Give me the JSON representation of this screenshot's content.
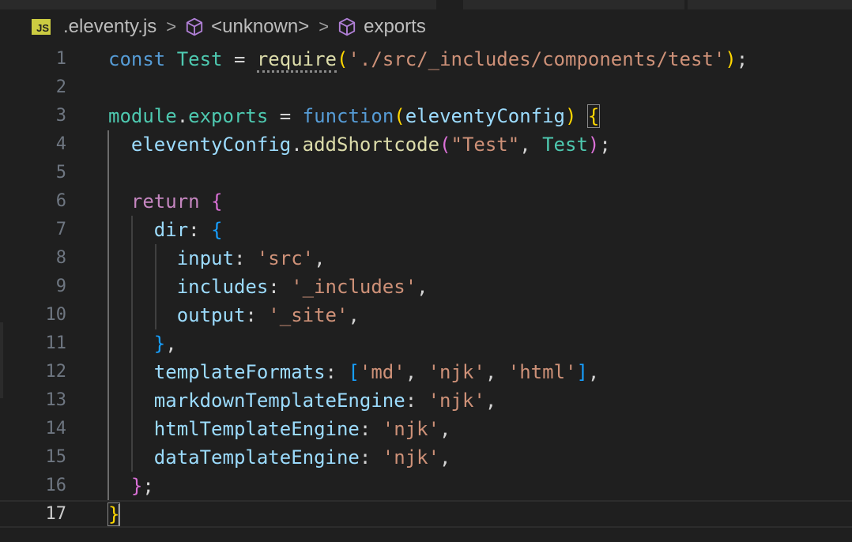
{
  "breadcrumb": {
    "file_icon_label": "JS",
    "file": ".eleventy.js",
    "item2": "<unknown>",
    "item3": "exports",
    "separator": ">"
  },
  "lines": [
    {
      "n": "1"
    },
    {
      "n": "2"
    },
    {
      "n": "3"
    },
    {
      "n": "4"
    },
    {
      "n": "5"
    },
    {
      "n": "6"
    },
    {
      "n": "7"
    },
    {
      "n": "8"
    },
    {
      "n": "9"
    },
    {
      "n": "10"
    },
    {
      "n": "11"
    },
    {
      "n": "12"
    },
    {
      "n": "13"
    },
    {
      "n": "14"
    },
    {
      "n": "15"
    },
    {
      "n": "16"
    },
    {
      "n": "17"
    }
  ],
  "tok": {
    "const": "const",
    "test_var": "Test",
    "eq": " = ",
    "require": "require",
    "lparen": "(",
    "rparen": ")",
    "require_path": "'./src/_includes/components/test'",
    "semi": ";",
    "module": "module",
    "dot": ".",
    "exports": "exports",
    "function": "function",
    "eleventyConfig": "eleventyConfig",
    "lbrace": "{",
    "rbrace": "}",
    "addShortcode": "addShortcode",
    "shortcode_name": "\"Test\"",
    "comma": ", ",
    "return": "return",
    "dir": "dir",
    "colon": ": ",
    "input": "input",
    "input_val": "'src'",
    "includes": "includes",
    "includes_val": "'_includes'",
    "output": "output",
    "output_val": "'_site'",
    "comma_only": ",",
    "templateFormats": "templateFormats",
    "lbracket": "[",
    "rbracket": "]",
    "fmt_md": "'md'",
    "fmt_njk": "'njk'",
    "fmt_html": "'html'",
    "markdownTemplateEngine": "markdownTemplateEngine",
    "htmlTemplateEngine": "htmlTemplateEngine",
    "dataTemplateEngine": "dataTemplateEngine",
    "njk": "'njk'"
  },
  "colors": {
    "background": "#1f1f1f",
    "keyword": "#569cd6",
    "control": "#c586c0",
    "variable": "#9cdcfe",
    "class": "#4ec9b0",
    "function": "#dcdcaa",
    "string": "#ce9178",
    "bracket_level1": "#ffd700",
    "bracket_level2": "#da70d6",
    "bracket_level3": "#179fff"
  },
  "icons": [
    "js-file-icon",
    "chevron-right-icon",
    "symbol-cube-icon"
  ]
}
